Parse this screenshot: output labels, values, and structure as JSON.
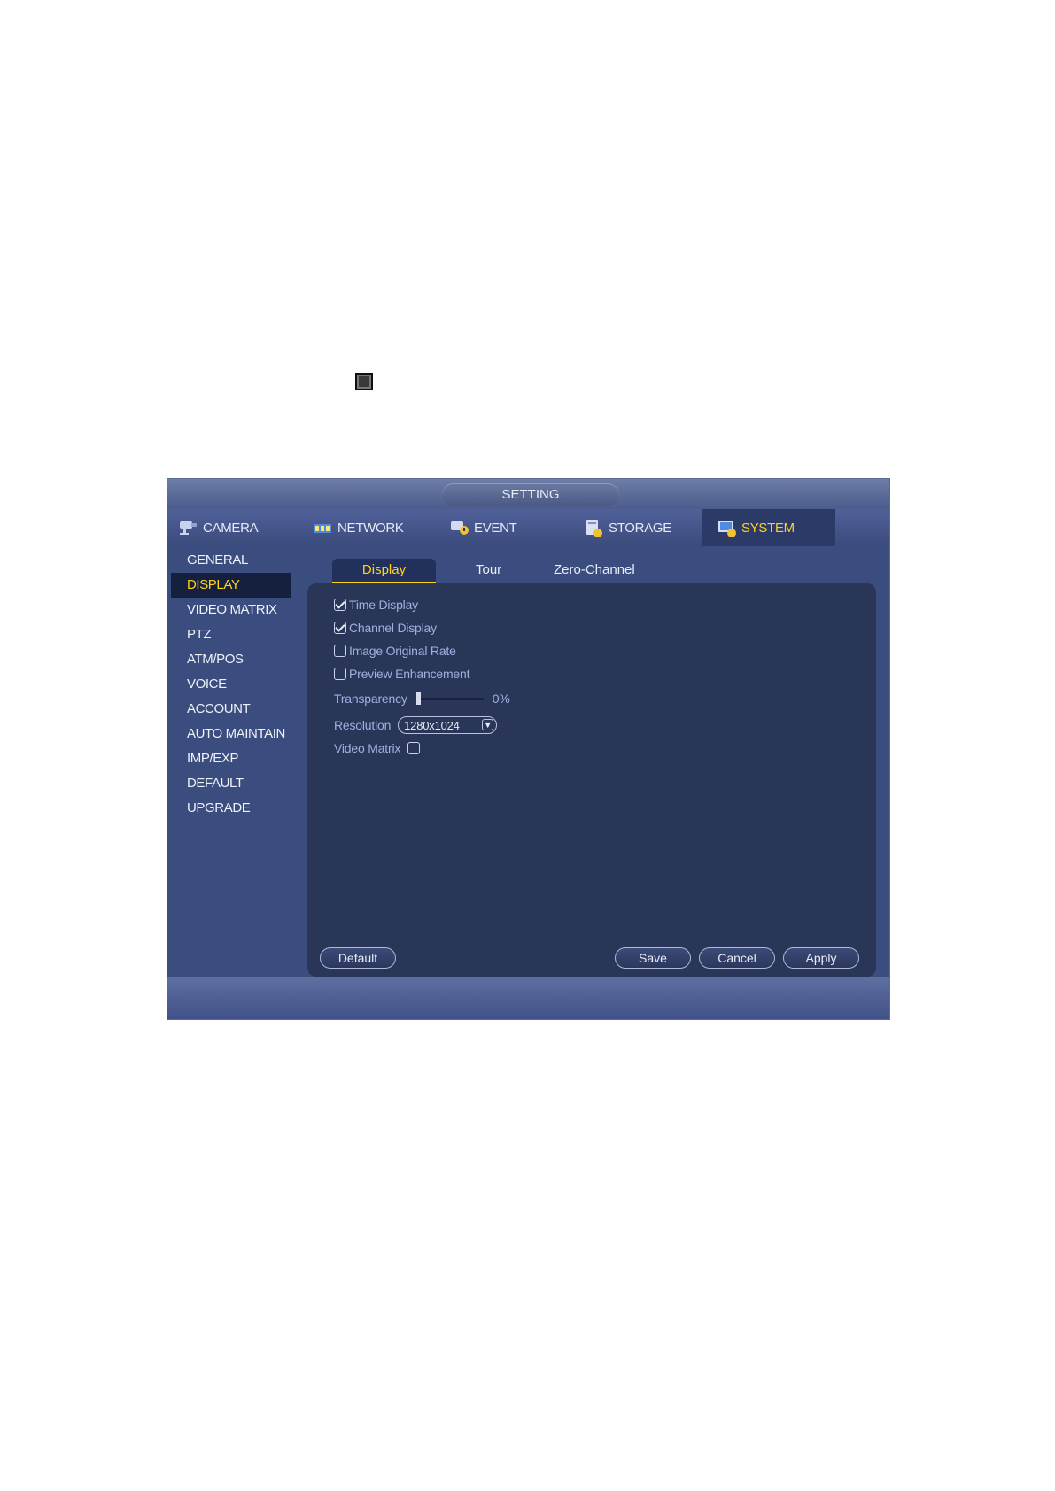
{
  "window": {
    "title": "SETTING"
  },
  "main_tabs": [
    {
      "label": "CAMERA",
      "icon": "camera-icon"
    },
    {
      "label": "NETWORK",
      "icon": "network-icon"
    },
    {
      "label": "EVENT",
      "icon": "event-icon"
    },
    {
      "label": "STORAGE",
      "icon": "storage-icon"
    },
    {
      "label": "SYSTEM",
      "icon": "system-icon",
      "active": true
    }
  ],
  "sidebar": {
    "items": [
      {
        "label": "GENERAL"
      },
      {
        "label": "DISPLAY",
        "active": true
      },
      {
        "label": "VIDEO MATRIX"
      },
      {
        "label": "PTZ"
      },
      {
        "label": "ATM/POS"
      },
      {
        "label": "VOICE"
      },
      {
        "label": "ACCOUNT"
      },
      {
        "label": "AUTO MAINTAIN"
      },
      {
        "label": "IMP/EXP"
      },
      {
        "label": "DEFAULT"
      },
      {
        "label": "UPGRADE"
      }
    ]
  },
  "sub_tabs": [
    {
      "label": "Display",
      "active": true
    },
    {
      "label": "Tour"
    },
    {
      "label": "Zero-Channel"
    }
  ],
  "options": {
    "time_display": {
      "label": "Time Display",
      "checked": true
    },
    "channel_display": {
      "label": "Channel Display",
      "checked": true
    },
    "image_original_rate": {
      "label": "Image Original Rate",
      "checked": false
    },
    "preview_enhancement": {
      "label": "Preview Enhancement",
      "checked": false
    },
    "transparency": {
      "label": "Transparency",
      "value_text": "0%",
      "value": 0
    },
    "resolution": {
      "label": "Resolution",
      "value": "1280x1024"
    },
    "video_matrix": {
      "label": "Video Matrix",
      "checked": false
    }
  },
  "buttons": {
    "default": "Default",
    "save": "Save",
    "cancel": "Cancel",
    "apply": "Apply"
  },
  "colors": {
    "active_text": "#ffd21a",
    "window_bg": "#3b4c7e",
    "panel_bg": "#2a3658"
  }
}
